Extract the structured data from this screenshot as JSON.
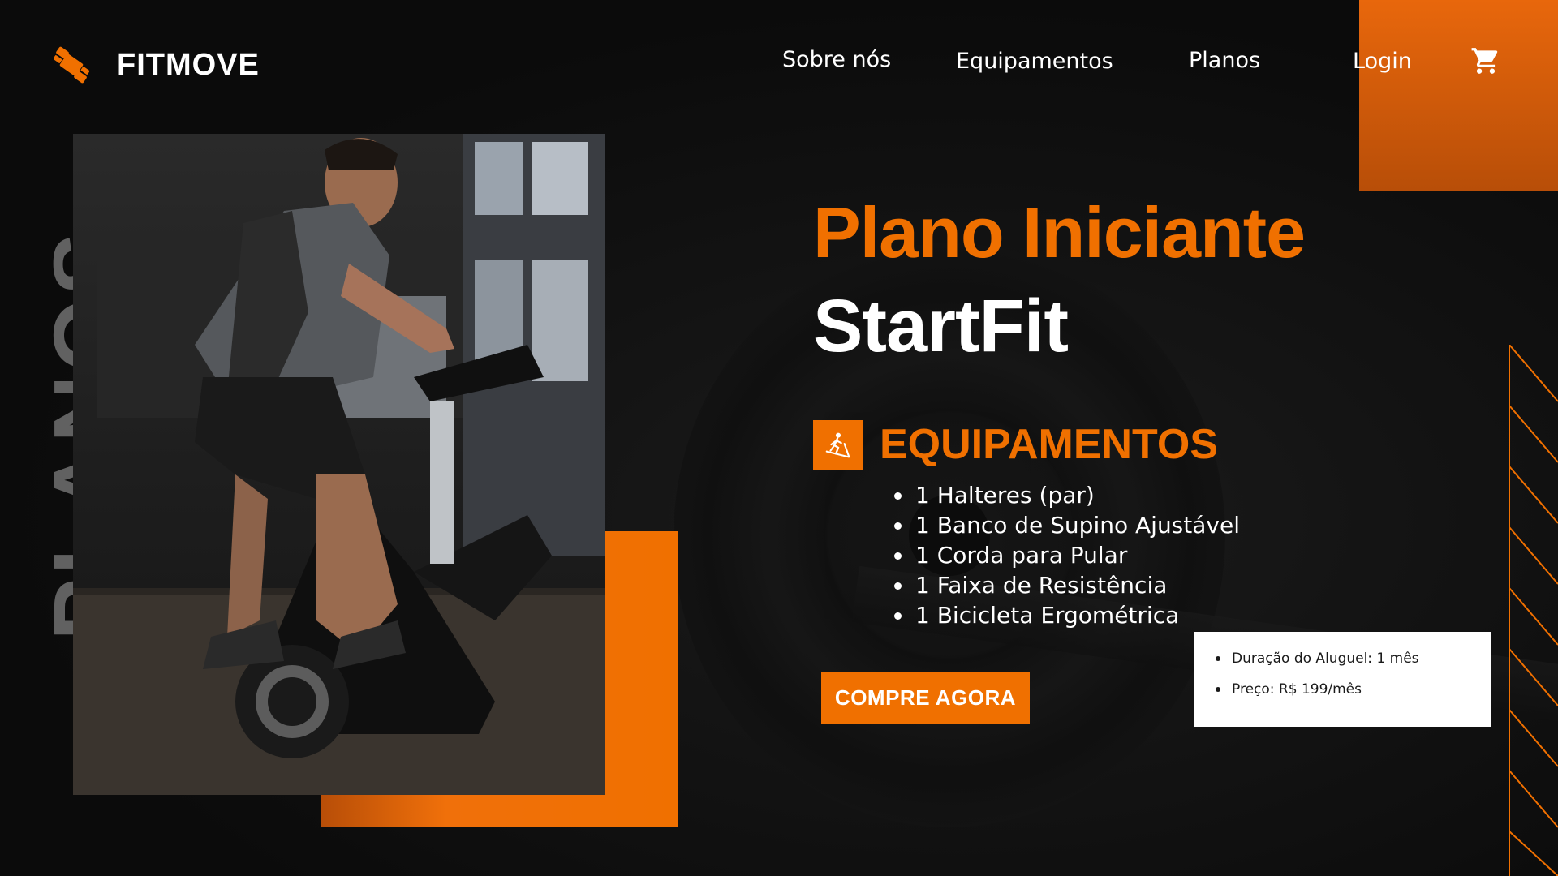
{
  "brand": {
    "name": "FITMOVE",
    "logo_icon": "dumbbell-icon",
    "accent_color": "#f07000"
  },
  "nav": {
    "items": [
      {
        "label": "Sobre nós"
      },
      {
        "label": "Equipamentos"
      },
      {
        "label": "Planos"
      },
      {
        "label": "Login"
      }
    ],
    "cart_icon": "cart-icon"
  },
  "side_label": "PLANOS",
  "hero": {
    "title_line1": "Plano Iniciante",
    "title_line2": "StartFit",
    "photo": "man-on-exercise-bike-photo"
  },
  "equipment": {
    "icon": "treadmill-icon",
    "heading": "EQUIPAMENTOS",
    "items": [
      "1 Halteres (par)",
      "1 Banco de Supino Ajustável",
      "1 Corda para Pular",
      "1 Faixa de Resistência",
      "1 Bicicleta Ergométrica"
    ]
  },
  "cta": {
    "label": "COMPRE AGORA"
  },
  "info": {
    "items": [
      "Duração do Aluguel: 1 mês",
      "Preço: R$ 199/mês"
    ]
  }
}
